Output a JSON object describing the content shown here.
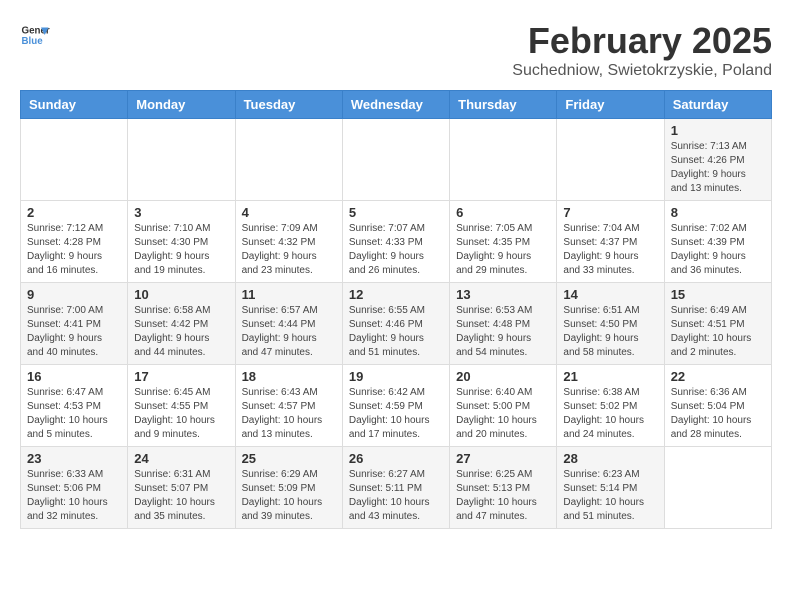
{
  "header": {
    "logo_general": "General",
    "logo_blue": "Blue",
    "title": "February 2025",
    "subtitle": "Suchedniow, Swietokrzyskie, Poland"
  },
  "days_of_week": [
    "Sunday",
    "Monday",
    "Tuesday",
    "Wednesday",
    "Thursday",
    "Friday",
    "Saturday"
  ],
  "weeks": [
    [
      {
        "day": "",
        "info": ""
      },
      {
        "day": "",
        "info": ""
      },
      {
        "day": "",
        "info": ""
      },
      {
        "day": "",
        "info": ""
      },
      {
        "day": "",
        "info": ""
      },
      {
        "day": "",
        "info": ""
      },
      {
        "day": "1",
        "info": "Sunrise: 7:13 AM\nSunset: 4:26 PM\nDaylight: 9 hours and 13 minutes."
      }
    ],
    [
      {
        "day": "2",
        "info": "Sunrise: 7:12 AM\nSunset: 4:28 PM\nDaylight: 9 hours and 16 minutes."
      },
      {
        "day": "3",
        "info": "Sunrise: 7:10 AM\nSunset: 4:30 PM\nDaylight: 9 hours and 19 minutes."
      },
      {
        "day": "4",
        "info": "Sunrise: 7:09 AM\nSunset: 4:32 PM\nDaylight: 9 hours and 23 minutes."
      },
      {
        "day": "5",
        "info": "Sunrise: 7:07 AM\nSunset: 4:33 PM\nDaylight: 9 hours and 26 minutes."
      },
      {
        "day": "6",
        "info": "Sunrise: 7:05 AM\nSunset: 4:35 PM\nDaylight: 9 hours and 29 minutes."
      },
      {
        "day": "7",
        "info": "Sunrise: 7:04 AM\nSunset: 4:37 PM\nDaylight: 9 hours and 33 minutes."
      },
      {
        "day": "8",
        "info": "Sunrise: 7:02 AM\nSunset: 4:39 PM\nDaylight: 9 hours and 36 minutes."
      }
    ],
    [
      {
        "day": "9",
        "info": "Sunrise: 7:00 AM\nSunset: 4:41 PM\nDaylight: 9 hours and 40 minutes."
      },
      {
        "day": "10",
        "info": "Sunrise: 6:58 AM\nSunset: 4:42 PM\nDaylight: 9 hours and 44 minutes."
      },
      {
        "day": "11",
        "info": "Sunrise: 6:57 AM\nSunset: 4:44 PM\nDaylight: 9 hours and 47 minutes."
      },
      {
        "day": "12",
        "info": "Sunrise: 6:55 AM\nSunset: 4:46 PM\nDaylight: 9 hours and 51 minutes."
      },
      {
        "day": "13",
        "info": "Sunrise: 6:53 AM\nSunset: 4:48 PM\nDaylight: 9 hours and 54 minutes."
      },
      {
        "day": "14",
        "info": "Sunrise: 6:51 AM\nSunset: 4:50 PM\nDaylight: 9 hours and 58 minutes."
      },
      {
        "day": "15",
        "info": "Sunrise: 6:49 AM\nSunset: 4:51 PM\nDaylight: 10 hours and 2 minutes."
      }
    ],
    [
      {
        "day": "16",
        "info": "Sunrise: 6:47 AM\nSunset: 4:53 PM\nDaylight: 10 hours and 5 minutes."
      },
      {
        "day": "17",
        "info": "Sunrise: 6:45 AM\nSunset: 4:55 PM\nDaylight: 10 hours and 9 minutes."
      },
      {
        "day": "18",
        "info": "Sunrise: 6:43 AM\nSunset: 4:57 PM\nDaylight: 10 hours and 13 minutes."
      },
      {
        "day": "19",
        "info": "Sunrise: 6:42 AM\nSunset: 4:59 PM\nDaylight: 10 hours and 17 minutes."
      },
      {
        "day": "20",
        "info": "Sunrise: 6:40 AM\nSunset: 5:00 PM\nDaylight: 10 hours and 20 minutes."
      },
      {
        "day": "21",
        "info": "Sunrise: 6:38 AM\nSunset: 5:02 PM\nDaylight: 10 hours and 24 minutes."
      },
      {
        "day": "22",
        "info": "Sunrise: 6:36 AM\nSunset: 5:04 PM\nDaylight: 10 hours and 28 minutes."
      }
    ],
    [
      {
        "day": "23",
        "info": "Sunrise: 6:33 AM\nSunset: 5:06 PM\nDaylight: 10 hours and 32 minutes."
      },
      {
        "day": "24",
        "info": "Sunrise: 6:31 AM\nSunset: 5:07 PM\nDaylight: 10 hours and 35 minutes."
      },
      {
        "day": "25",
        "info": "Sunrise: 6:29 AM\nSunset: 5:09 PM\nDaylight: 10 hours and 39 minutes."
      },
      {
        "day": "26",
        "info": "Sunrise: 6:27 AM\nSunset: 5:11 PM\nDaylight: 10 hours and 43 minutes."
      },
      {
        "day": "27",
        "info": "Sunrise: 6:25 AM\nSunset: 5:13 PM\nDaylight: 10 hours and 47 minutes."
      },
      {
        "day": "28",
        "info": "Sunrise: 6:23 AM\nSunset: 5:14 PM\nDaylight: 10 hours and 51 minutes."
      },
      {
        "day": "",
        "info": ""
      }
    ]
  ]
}
